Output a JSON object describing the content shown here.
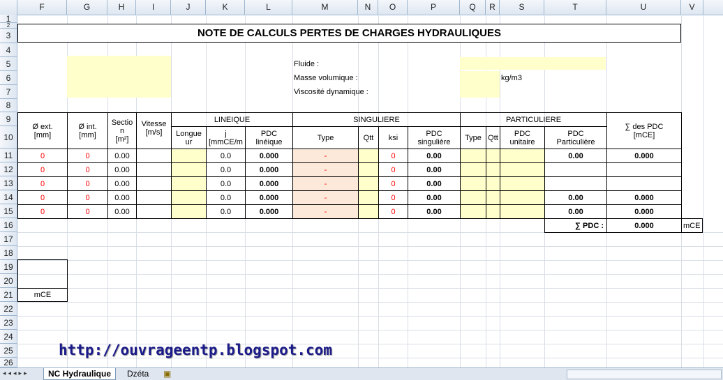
{
  "columns": [
    "F",
    "G",
    "H",
    "I",
    "J",
    "K",
    "L",
    "M",
    "N",
    "O",
    "P",
    "Q",
    "R",
    "S",
    "T",
    "U",
    "V"
  ],
  "rows": [
    "1",
    "2",
    "3",
    "4",
    "5",
    "6",
    "7",
    "8",
    "9",
    "10",
    "11",
    "12",
    "13",
    "14",
    "15",
    "16",
    "17",
    "18",
    "19",
    "20",
    "21",
    "22",
    "23",
    "24",
    "25",
    "26"
  ],
  "title": "NOTE DE CALCULS PERTES DE CHARGES HYDRAULIQUES",
  "fluid": {
    "fluide_label": "Fluide :",
    "masse_label": "Masse volumique :",
    "masse_unit": "kg/m3",
    "viscosite_label": "Viscosité dynamique :"
  },
  "headers": {
    "ext_line1": "Ø ext.",
    "ext_line2": "[mm]",
    "int_line1": "Ø int.",
    "int_line2": "[mm]",
    "section_l1": "Sectio",
    "section_l2": "n",
    "section_l3": "[m²]",
    "vitesse_l1": "Vitesse",
    "vitesse_l2": "[m/s]",
    "lineique": "LINEIQUE",
    "longueur_l1": "Longue",
    "longueur_l2": "ur",
    "j_l1": "j",
    "j_l2": "[mmCE/m",
    "pdcl_l1": "PDC",
    "pdcl_l2": "linéique",
    "singuliere": "SINGULIERE",
    "type": "Type",
    "qtt": "Qtt",
    "ksi": "ksi",
    "pdcs_l1": "PDC",
    "pdcs_l2": "singulière",
    "particuliere": "PARTICULIERE",
    "type_p": "Type",
    "qtt_p": "Qtt",
    "pdcu_l1": "PDC",
    "pdcu_l2": "unitaire",
    "pdcp_l1": "PDC",
    "pdcp_l2": "Particulière",
    "sum_l1": "∑ des PDC",
    "sum_l2": "[mCE]"
  },
  "table_rows": [
    {
      "ext": "0",
      "int": "0",
      "section": "0.00",
      "j": "0.0",
      "pdc_lin": "0.000",
      "type": "-",
      "ksi": "0",
      "pdc_sing": "0.00",
      "pdc_part": "0.00",
      "sum": "0.000"
    },
    {
      "ext": "0",
      "int": "0",
      "section": "0.00",
      "j": "0.0",
      "pdc_lin": "0.000",
      "type": "-",
      "ksi": "0",
      "pdc_sing": "0.00",
      "pdc_part": "",
      "sum": ""
    },
    {
      "ext": "0",
      "int": "0",
      "section": "0.00",
      "j": "0.0",
      "pdc_lin": "0.000",
      "type": "-",
      "ksi": "0",
      "pdc_sing": "0.00",
      "pdc_part": "",
      "sum": ""
    },
    {
      "ext": "0",
      "int": "0",
      "section": "0.00",
      "j": "0.0",
      "pdc_lin": "0.000",
      "type": "-",
      "ksi": "0",
      "pdc_sing": "0.00",
      "pdc_part": "0.00",
      "sum": "0.000"
    },
    {
      "ext": "0",
      "int": "0",
      "section": "0.00",
      "j": "0.0",
      "pdc_lin": "0.000",
      "type": "-",
      "ksi": "0",
      "pdc_sing": "0.00",
      "pdc_part": "0.00",
      "sum": "0.000"
    }
  ],
  "total": {
    "label": "∑ PDC :",
    "value": "0.000",
    "unit": "mCE"
  },
  "side_box_unit": "mCE",
  "watermark": "http://ouvrageentp.blogspot.com",
  "tabs": {
    "active": "NC Hydraulique",
    "second": "Dzéta"
  }
}
